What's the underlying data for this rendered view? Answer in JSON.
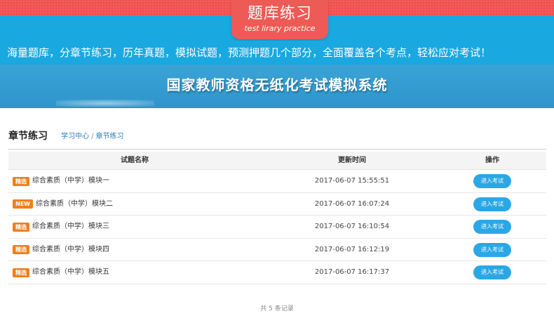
{
  "banner": {
    "title_cn": "题库练习",
    "title_en": "test lirary practice",
    "intro": "海量题库，分章节练习，历年真题，模拟试题，预测押题几个部分，全面覆盖各个考点，轻松应对考试！",
    "hero_title": "国家教师资格无纸化考试模拟系统"
  },
  "section": {
    "title": "章节练习",
    "breadcrumb": [
      "学习中心",
      "章节练习"
    ]
  },
  "table": {
    "headers": {
      "name": "试题名称",
      "time": "更新时间",
      "op": "操作"
    },
    "rows": [
      {
        "tag": "精选",
        "name": "综合素质（中学）模块一",
        "time": "2017-06-07 15:55:51",
        "action": "进入考试"
      },
      {
        "tag": "NEW",
        "name": "综合素质（中学）模块二",
        "time": "2017-06-07 16:07:24",
        "action": "进入考试"
      },
      {
        "tag": "精选",
        "name": "综合素质（中学）模块三",
        "time": "2017-06-07 16:10:54",
        "action": "进入考试"
      },
      {
        "tag": "精选",
        "name": "综合素质（中学）模块四",
        "time": "2017-06-07 16:12:19",
        "action": "进入考试"
      },
      {
        "tag": "精选",
        "name": "综合素质（中学）模块五",
        "time": "2017-06-07 16:17:37",
        "action": "进入考试"
      }
    ]
  },
  "footer": {
    "count_text": "共 5 条记录"
  },
  "colors": {
    "accent_red": "#ee5a55",
    "accent_blue": "#1aa8e0",
    "tag_orange": "#f07f1a",
    "button_blue": "#2aa8e6"
  }
}
